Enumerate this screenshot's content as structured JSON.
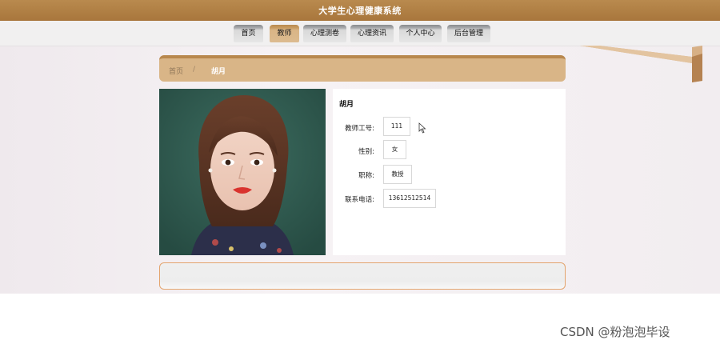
{
  "app": {
    "title": "大学生心理健康系统"
  },
  "nav": {
    "items": [
      {
        "label": "首页",
        "active": false
      },
      {
        "label": "教师",
        "active": true
      },
      {
        "label": "心理测卷",
        "active": false
      },
      {
        "label": "心理资讯",
        "active": false
      },
      {
        "label": "个人中心",
        "active": false
      },
      {
        "label": "后台管理",
        "active": false
      }
    ]
  },
  "breadcrumb": {
    "home": "首页",
    "separator": "/",
    "current": "胡月"
  },
  "teacher": {
    "name": "胡月",
    "fields": [
      {
        "label": "教师工号:",
        "value": "111"
      },
      {
        "label": "性别:",
        "value": "女"
      },
      {
        "label": "职称:",
        "value": "教授"
      },
      {
        "label": "联系电话:",
        "value": "13612512514"
      }
    ]
  },
  "watermark": "CSDN @粉泡泡毕设",
  "colors": {
    "brand": "#a8763c",
    "breadcrumb_bg": "#d9b587",
    "active_tab": "#d9b586",
    "panel_border": "#e3a46e"
  }
}
